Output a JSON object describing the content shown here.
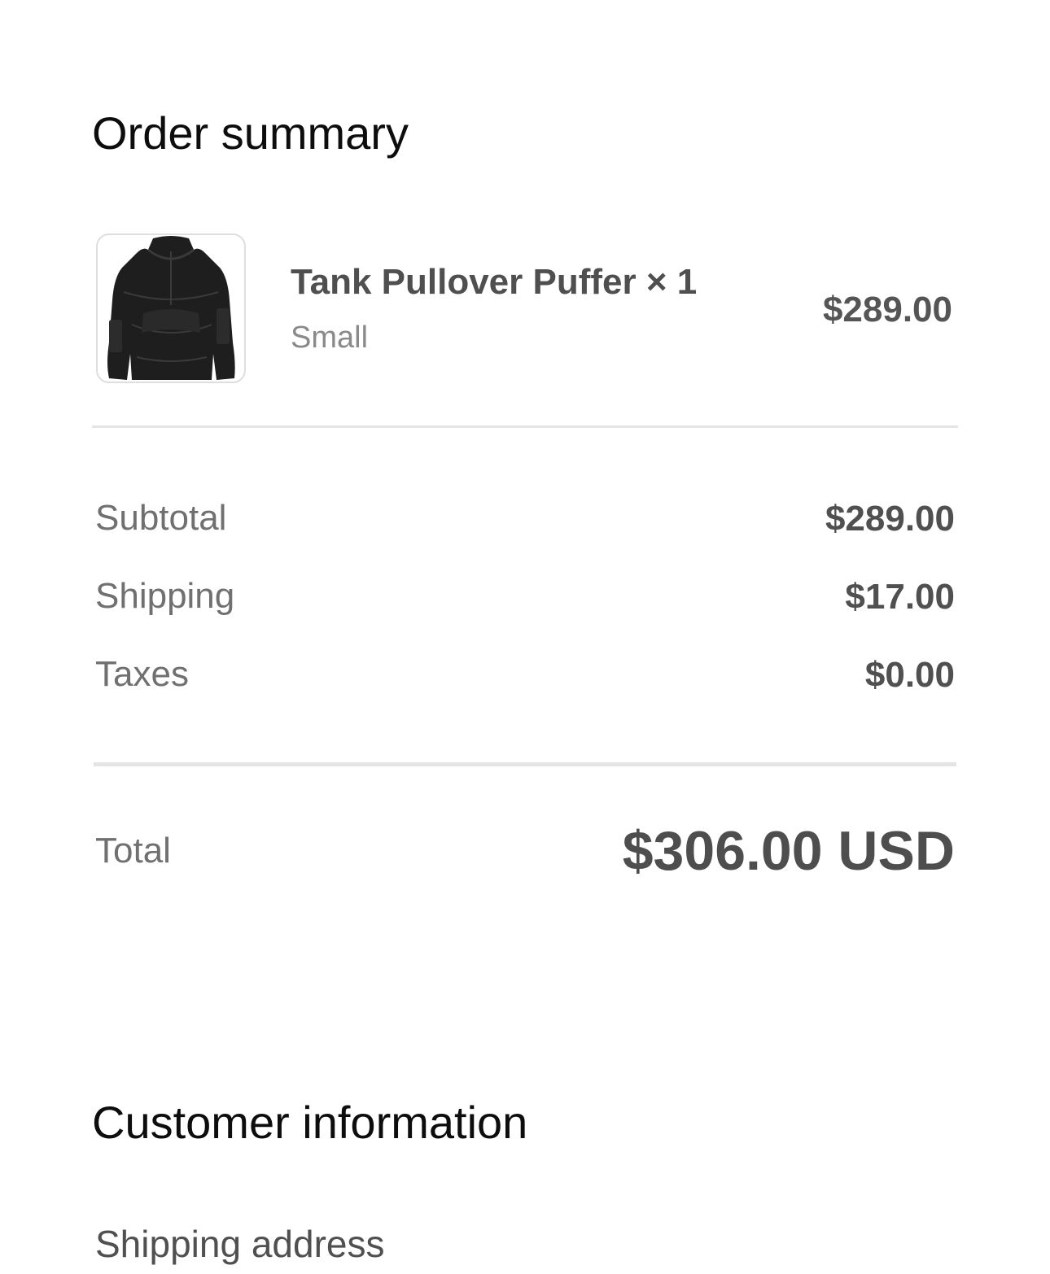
{
  "order_summary": {
    "title": "Order summary",
    "item": {
      "name": "Tank Pullover Puffer × 1",
      "variant": "Small",
      "price": "$289.00",
      "image_icon": "puffer-jacket-thumbnail"
    },
    "rows": {
      "subtotal": {
        "label": "Subtotal",
        "value": "$289.00"
      },
      "shipping": {
        "label": "Shipping",
        "value": "$17.00"
      },
      "taxes": {
        "label": "Taxes",
        "value": "$0.00"
      }
    },
    "total": {
      "label": "Total",
      "value": "$306.00 USD"
    }
  },
  "customer_information": {
    "title": "Customer information",
    "shipping_address_heading": "Shipping address"
  }
}
